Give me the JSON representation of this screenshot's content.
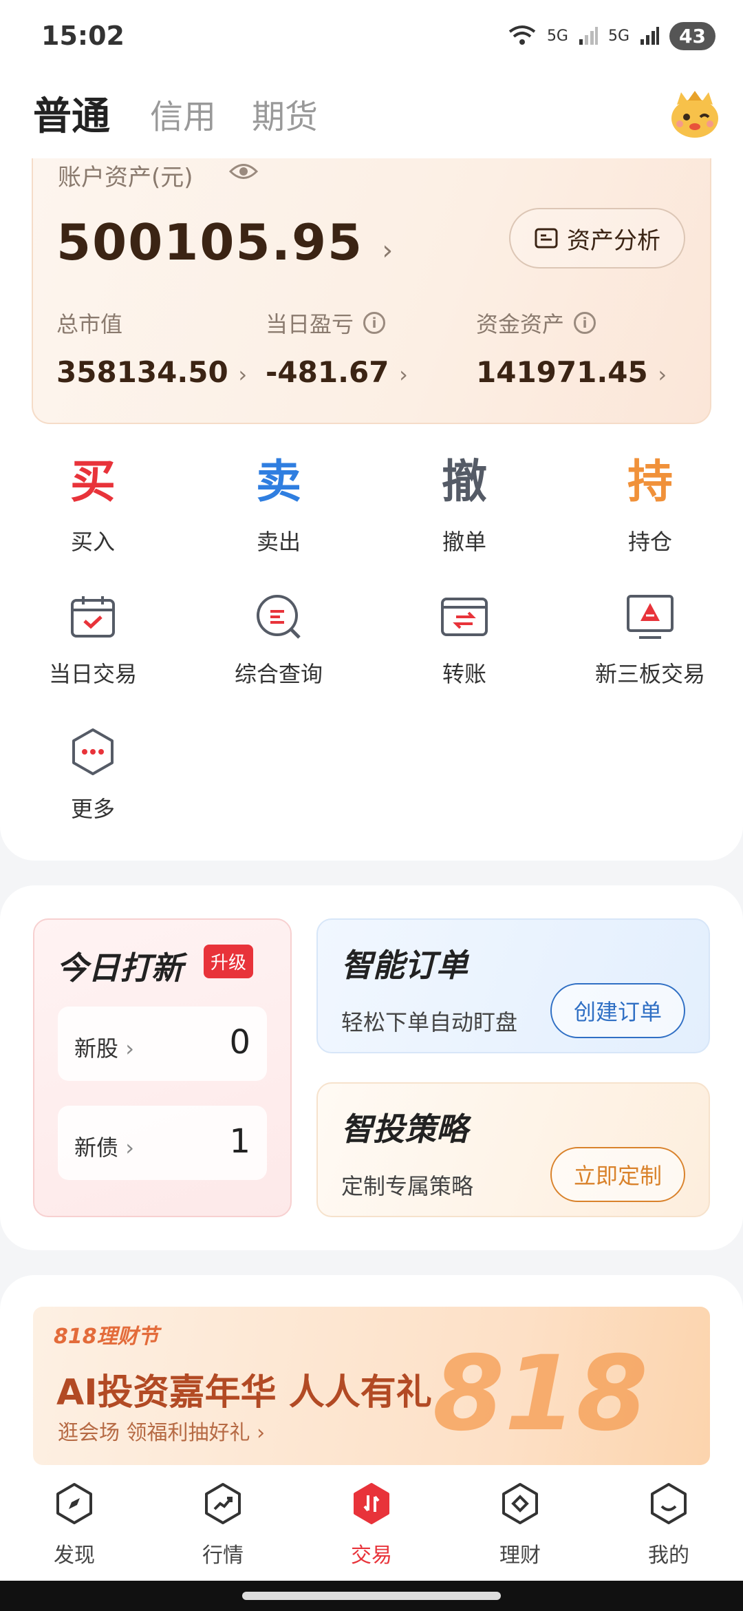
{
  "status": {
    "time": "15:02",
    "signal1": "5G",
    "signal2": "5G",
    "battery": "43"
  },
  "tabs": [
    {
      "label": "普通",
      "active": true
    },
    {
      "label": "信用",
      "active": false
    },
    {
      "label": "期货",
      "active": false
    }
  ],
  "assets": {
    "label": "账户资产(元)",
    "total": "500105.95",
    "analysis_btn": "资产分析",
    "market_value": {
      "label": "总市值",
      "value": "358134.50"
    },
    "daily_pnl": {
      "label": "当日盈亏",
      "value": "-481.67"
    },
    "cash": {
      "label": "资金资产",
      "value": "141971.45"
    }
  },
  "actions": [
    {
      "glyph": "买",
      "label": "买入",
      "color": "#e8333a"
    },
    {
      "glyph": "卖",
      "label": "卖出",
      "color": "#2f7ee0"
    },
    {
      "glyph": "撤",
      "label": "撤单",
      "color": "#555b66"
    },
    {
      "glyph": "持",
      "label": "持仓",
      "color": "#f0913a"
    }
  ],
  "tools": [
    {
      "icon": "calendar-check-icon",
      "label": "当日交易"
    },
    {
      "icon": "search-query-icon",
      "label": "综合查询"
    },
    {
      "icon": "transfer-icon",
      "label": "转账"
    },
    {
      "icon": "board-trade-icon",
      "label": "新三板交易"
    },
    {
      "icon": "more-dots-icon",
      "label": "更多"
    }
  ],
  "ipo": {
    "title": "今日打新",
    "badge": "升级",
    "stock_label": "新股",
    "stock_count": "0",
    "bond_label": "新债",
    "bond_count": "1"
  },
  "smart_order": {
    "title": "智能订单",
    "subtitle": "轻松下单自动盯盘",
    "button": "创建订单",
    "color": "#2f6fc4"
  },
  "strategy": {
    "title": "智投策略",
    "subtitle": "定制专属策略",
    "button": "立即定制",
    "color": "#d9822b"
  },
  "banner": {
    "tag": "818理财节",
    "headline": "AI投资嘉年华 人人有礼",
    "sub": "逛会场 领福利抽好礼",
    "graphic": "818"
  },
  "nav": [
    {
      "label": "发现",
      "icon": "compass-icon",
      "active": false
    },
    {
      "label": "行情",
      "icon": "trend-icon",
      "active": false
    },
    {
      "label": "交易",
      "icon": "trade-icon",
      "active": true
    },
    {
      "label": "理财",
      "icon": "wealth-icon",
      "active": false
    },
    {
      "label": "我的",
      "icon": "profile-icon",
      "active": false
    }
  ]
}
